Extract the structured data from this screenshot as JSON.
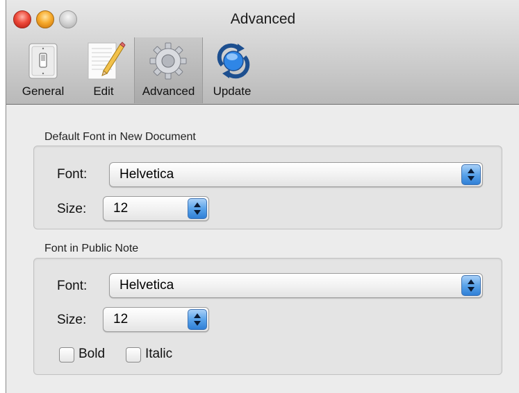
{
  "window": {
    "title": "Advanced"
  },
  "toolbar": {
    "items": [
      {
        "label": "General",
        "icon": "light-switch-icon"
      },
      {
        "label": "Edit",
        "icon": "notepad-pencil-icon"
      },
      {
        "label": "Advanced",
        "icon": "gear-icon",
        "selected": true
      },
      {
        "label": "Update",
        "icon": "refresh-icon"
      }
    ]
  },
  "default_font": {
    "section_title": "Default Font in New Document",
    "font_label": "Font:",
    "font_value": "Helvetica",
    "size_label": "Size:",
    "size_value": "12"
  },
  "public_note": {
    "section_title": "Font in Public Note",
    "font_label": "Font:",
    "font_value": "Helvetica",
    "size_label": "Size:",
    "size_value": "12",
    "bold_label": "Bold",
    "bold_checked": false,
    "italic_label": "Italic",
    "italic_checked": false
  },
  "colors": {
    "accent": "#3a86e0"
  }
}
